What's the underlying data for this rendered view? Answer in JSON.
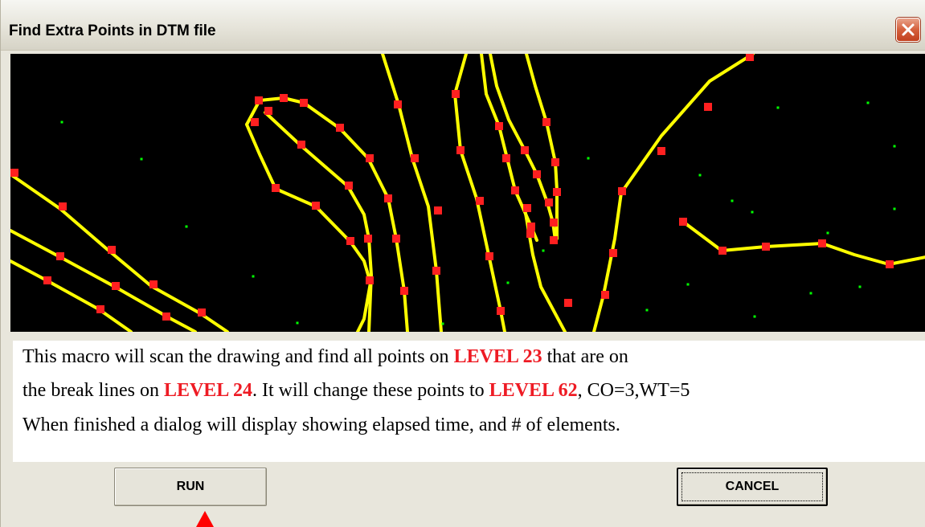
{
  "window": {
    "title": "Find Extra Points in DTM file",
    "close_icon": "close-icon"
  },
  "description": {
    "line1_a": "This macro will scan the drawing and find all points on ",
    "line1_level": "LEVEL 23",
    "line1_b": " that are on",
    "line2_a": "the break lines on ",
    "line2_level": "LEVEL 24",
    "line2_b": ". It will change these points to ",
    "line2_level2": "LEVEL 62",
    "line2_c": ", CO=3,WT=5",
    "line3": "When finished a dialog will display showing elapsed time, and # of elements."
  },
  "buttons": {
    "run": "RUN",
    "cancel": "CANCEL"
  },
  "colors": {
    "canvas_bg": "#000000",
    "breakline": "#ffff00",
    "vertex": "#ff2020",
    "dtm_point": "#00ff00",
    "level_highlight": "#ee1b24"
  }
}
